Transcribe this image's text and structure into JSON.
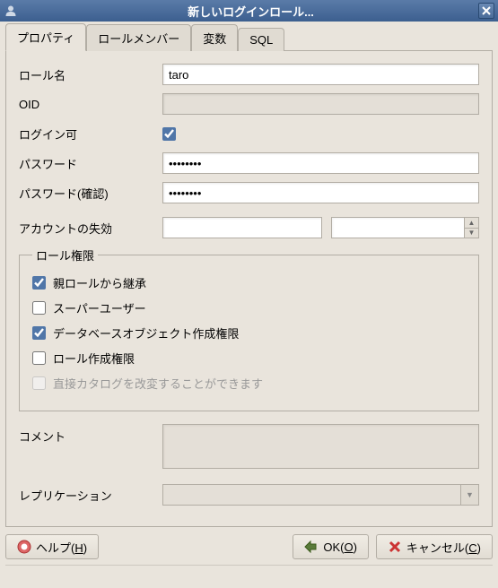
{
  "window": {
    "title": "新しいログインロール..."
  },
  "tabs": {
    "properties": "プロパティ",
    "role_members": "ロールメンバー",
    "variables": "変数",
    "sql": "SQL"
  },
  "labels": {
    "role_name": "ロール名",
    "oid": "OID",
    "can_login": "ログイン可",
    "password": "パスワード",
    "password_confirm": "パスワード(確認)",
    "account_expires": "アカウントの失効",
    "role_privileges": "ロール権限",
    "inherit": "親ロールから継承",
    "superuser": "スーパーユーザー",
    "create_db": "データベースオブジェクト作成権限",
    "create_role": "ロール作成権限",
    "update_catalog": "直接カタログを改変することができます",
    "comment": "コメント",
    "replication": "レプリケーション"
  },
  "values": {
    "role_name": "taro",
    "oid": "",
    "password": "••••••••",
    "password_confirm": "••••••••",
    "expire_date": "",
    "expire_count": "",
    "can_login": true,
    "inherit": true,
    "superuser": false,
    "create_db": true,
    "create_role": false,
    "update_catalog": false,
    "comment": "",
    "replication": ""
  },
  "buttons": {
    "help_prefix": "ヘルプ(",
    "help_key": "H",
    "help_suffix": ")",
    "ok_prefix": "OK(",
    "ok_key": "O",
    "ok_suffix": ")",
    "cancel_prefix": "キャンセル(",
    "cancel_key": "C",
    "cancel_suffix": ")"
  }
}
